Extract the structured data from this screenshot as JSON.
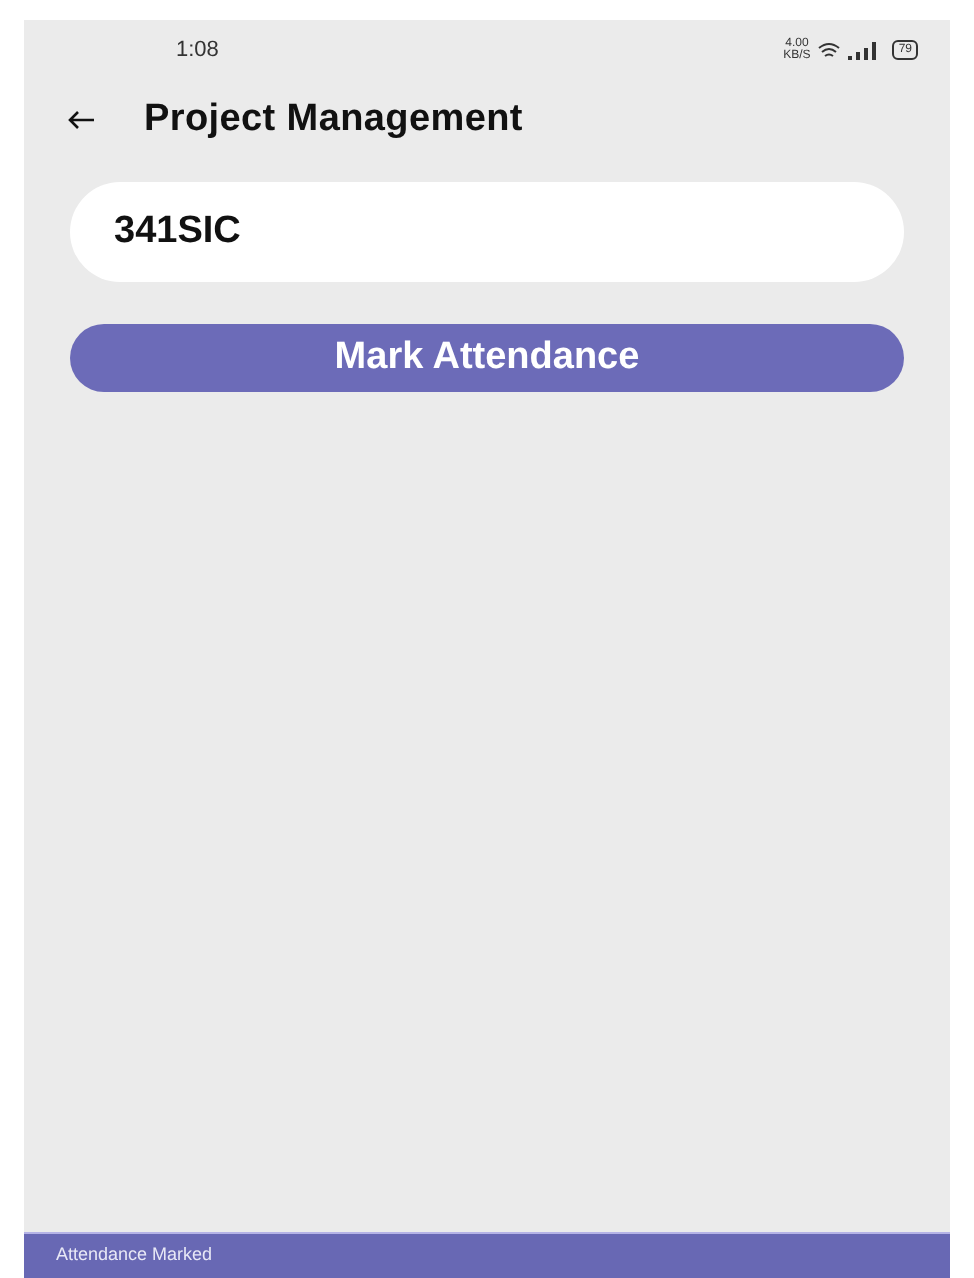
{
  "status_bar": {
    "time": "1:08",
    "net_speed": "4.00",
    "net_unit": "KB/S",
    "battery": "79"
  },
  "app_bar": {
    "title": "Project Management"
  },
  "code_field": {
    "value": "341SIC"
  },
  "button": {
    "label": "Mark Attendance"
  },
  "snackbar": {
    "message": "Attendance Marked"
  }
}
